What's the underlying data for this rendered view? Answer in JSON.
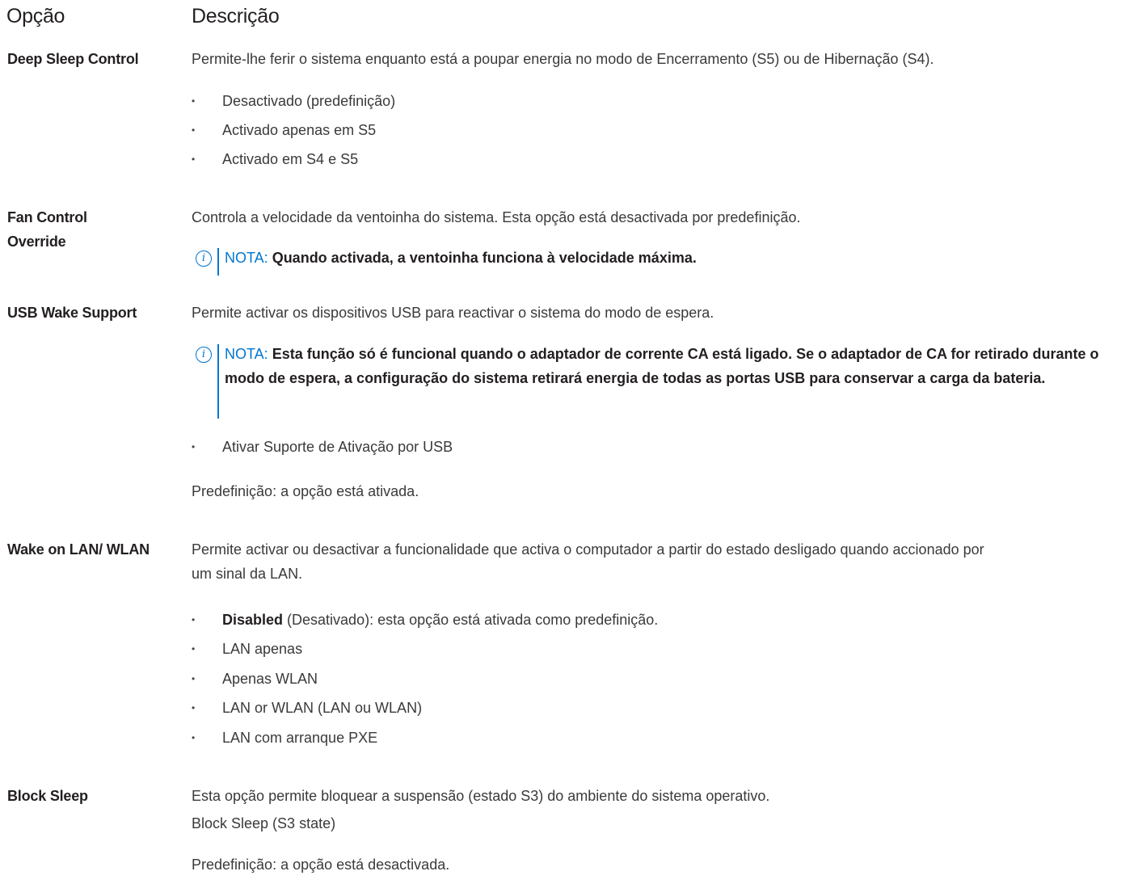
{
  "header": {
    "col_option": "Opção",
    "col_description": "Descrição"
  },
  "deep_sleep": {
    "option": "Deep Sleep Control",
    "description": "Permite-lhe ferir o sistema enquanto está a poupar energia no modo de Encerramento (S5) ou de Hibernação (S4).",
    "items": [
      "Desactivado (predefinição)",
      "Activado apenas em S5",
      "Activado em S4 e S5"
    ]
  },
  "fan_control": {
    "option": "Fan Control Override",
    "description": "Controla a velocidade da ventoinha do sistema. Esta opção está desactivada por predefinição.",
    "note_label": "NOTA:",
    "note_text": "Quando activada, a ventoinha funciona à velocidade máxima."
  },
  "usb_wake": {
    "option": "USB Wake Support",
    "description": "Permite activar os dispositivos USB para reactivar o sistema do modo de espera.",
    "note_label": "NOTA:",
    "note_text": "Esta função só é funcional quando o adaptador de corrente CA está ligado. Se o adaptador de CA for retirado durante o modo de espera, a configuração do sistema retirará energia de todas as portas USB para conservar a carga da bateria.",
    "items": [
      "Ativar Suporte de Ativação por USB"
    ],
    "default_text": "Predefinição: a opção está ativada."
  },
  "wake_on_lan": {
    "option": "Wake on LAN/ WLAN",
    "description": "Permite activar ou desactivar a funcionalidade que activa o computador a partir do estado desligado quando accionado por um sinal da LAN.",
    "item0_bold": "Disabled",
    "item0_rest": " (Desativado): esta opção está ativada como predefinição.",
    "items": [
      "LAN apenas",
      "Apenas WLAN",
      "LAN or WLAN (LAN ou WLAN)",
      "LAN com arranque PXE"
    ]
  },
  "block_sleep": {
    "option": "Block Sleep",
    "description": "Esta opção permite bloquear a suspensão (estado S3) do ambiente do sistema operativo.",
    "setting": "Block Sleep (S3 state)",
    "default_text": "Predefinição: a opção está desactivada."
  },
  "colors": {
    "text": "#231f20",
    "note_accent": "#0076ce"
  },
  "icons": {
    "note_icon": "info-icon",
    "list_bullet": "•"
  }
}
